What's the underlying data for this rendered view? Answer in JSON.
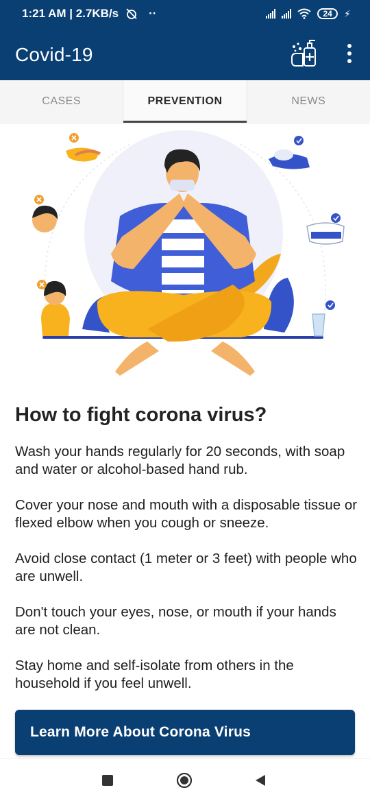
{
  "status_bar": {
    "time_speed": "1:21 AM | 2.7KB/s",
    "dots": "··",
    "battery": "24",
    "icons": [
      "alarm-off-icon",
      "signal-icon",
      "signal-icon",
      "wifi-icon",
      "battery-icon",
      "charging-icon"
    ]
  },
  "app_bar": {
    "title": "Covid-19",
    "actions": [
      "hand-sanitizer-icon",
      "more-vert-icon"
    ]
  },
  "tabs": [
    {
      "label": "CASES",
      "active": false
    },
    {
      "label": "PREVENTION",
      "active": true
    },
    {
      "label": "NEWS",
      "active": false
    }
  ],
  "content": {
    "heading": "How to fight corona virus?",
    "tips": [
      "Wash your hands regularly for 20 seconds, with soap and water or alcohol-based hand rub.",
      "Cover your nose and mouth with a disposable tissue or flexed elbow when you cough or sneeze.",
      "Avoid close contact (1 meter or 3 feet) with people who are unwell.",
      "Don't touch your eyes, nose, or mouth if your hands are not clean.",
      "Stay home and self-isolate from others in the household if you feel unwell."
    ],
    "button_label": "Learn More About Corona Virus"
  },
  "colors": {
    "primary": "#0a3f73",
    "shirt_blue": "#3f5ed8",
    "pants_orange": "#f7b21e",
    "cross_orange": "#f0a030",
    "check_blue": "#3553c9"
  },
  "nav_bar": {
    "icons": [
      "recent-apps-icon",
      "home-icon",
      "back-icon"
    ]
  }
}
